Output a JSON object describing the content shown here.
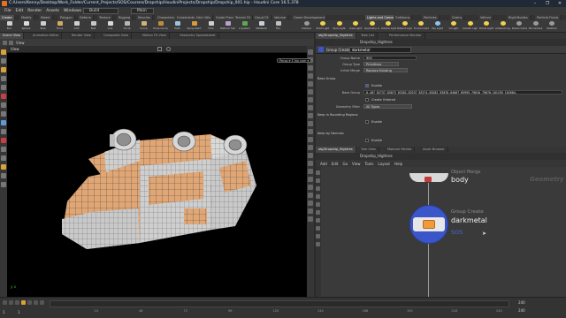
{
  "window": {
    "title": "C:/Users/Kenny/Desktop/Work_Folder/Current_Projects/SOS/Courses/Dropship/HoudiniProjects/Dropship/Dropship_001.hip - Houdini Core 16.5.378",
    "controls": [
      "–",
      "❐",
      "✕"
    ]
  },
  "menu": {
    "items": [
      "File",
      "Edit",
      "Render",
      "Assets",
      "Windows",
      "Help"
    ],
    "desktop": "Build",
    "context": "Main"
  },
  "shelf_tabs_left": [
    "Create",
    "Modify",
    "Model",
    "Polygon",
    "Deform",
    "Texture",
    "Rigging",
    "Muscles",
    "Characters",
    "Constraints",
    "Hair Utils",
    "Guide Process",
    "Terrain FX",
    "Cloud FX",
    "Volume",
    "Game Development"
  ],
  "shelf_tools_left": [
    "Box",
    "Sphere",
    "Tube",
    "Torus",
    "Grid",
    "Null",
    "Line",
    "Circle",
    "Curve",
    "Draw Curve",
    "Path",
    "Spray Paint",
    "Font",
    "Platonic Solids",
    "L-System",
    "Metaball",
    "File"
  ],
  "shelf_tabs_right": [
    "Lights and Cameras",
    "Collisions",
    "Particles",
    "Grains",
    "Vellum",
    "Rigid Bodies",
    "Particle Fluids"
  ],
  "shelf_tools_right": [
    "Camera",
    "Point Light",
    "Spot Light",
    "Area Light",
    "Geometry Light",
    "Volume Light",
    "Distant Light",
    "Environment Light",
    "Sky Light",
    "GI Light",
    "Caustic Light",
    "Portal Light",
    "Ambient Light",
    "Stereo Camera",
    "VR Camera",
    "Switcher"
  ],
  "viewport": {
    "tabs": [
      "Scene View",
      "Animation Editor",
      "Render View",
      "Composite View",
      "Motion FX View",
      "Geometry Spreadsheet"
    ],
    "toolbar_label": "View",
    "persp_btn": "Persp ▾",
    "cam_btn": "No cam ▾",
    "axis_label": "y  x"
  },
  "timeline": {
    "frame_start": "1",
    "frame_end": "240",
    "current_frame": "1",
    "range_in": "1",
    "range_out": "240",
    "tick_labels": [
      "24",
      "48",
      "72",
      "96",
      "120",
      "144",
      "168",
      "192",
      "216",
      "240"
    ]
  },
  "params": {
    "tabs": [
      "obj/Dropship_Hightres",
      "Take List",
      "Performance Monitor"
    ],
    "path": "Dropship_Hightres",
    "node_type_label": "Group Create",
    "node_name": "darkmetal",
    "group_name_label": "Group Name",
    "group_name": "905",
    "group_type_label": "Group Type",
    "group_type": "Primitives",
    "initial_merge_label": "Initial Merge",
    "initial_merge": "Replace Existing",
    "base_group_section": "Base Group",
    "enable_label": "Enable",
    "base_group_label": "Base Group",
    "base_group_value": "0-407 82737-83073 83262-83237 83274-83282 83876-84067 85995-79610 79670-101195 102604-",
    "create_ordered_label": "Create Ordered",
    "geometry_filter_label": "Geometry Filter",
    "geometry_filter": "All Types",
    "bounding_section": "Keep in Bounding Regions",
    "bounding_enable_label": "Enable",
    "normals_section": "Keep by Normals",
    "normals_enable_label": "Enable"
  },
  "network": {
    "tabs": [
      "obj/Dropship_Hightres",
      "Tree View",
      "Material Palette",
      "Asset Browser"
    ],
    "path": "Dropship_Hightres",
    "menu": [
      "Add",
      "Edit",
      "Go",
      "View",
      "Tools",
      "Layout",
      "Help"
    ],
    "context_label": "Geometry",
    "node_above_type": "Object Merge",
    "node_above_name": "body",
    "node_type": "Group Create",
    "node_name": "darkmetal",
    "node_comment": "SOS"
  },
  "colors": {
    "ship_orange": "#e0a674",
    "ship_grey": "#c9c9c9",
    "selected_node": "#3a56c8",
    "houdini_orange": "#e86f1b"
  }
}
